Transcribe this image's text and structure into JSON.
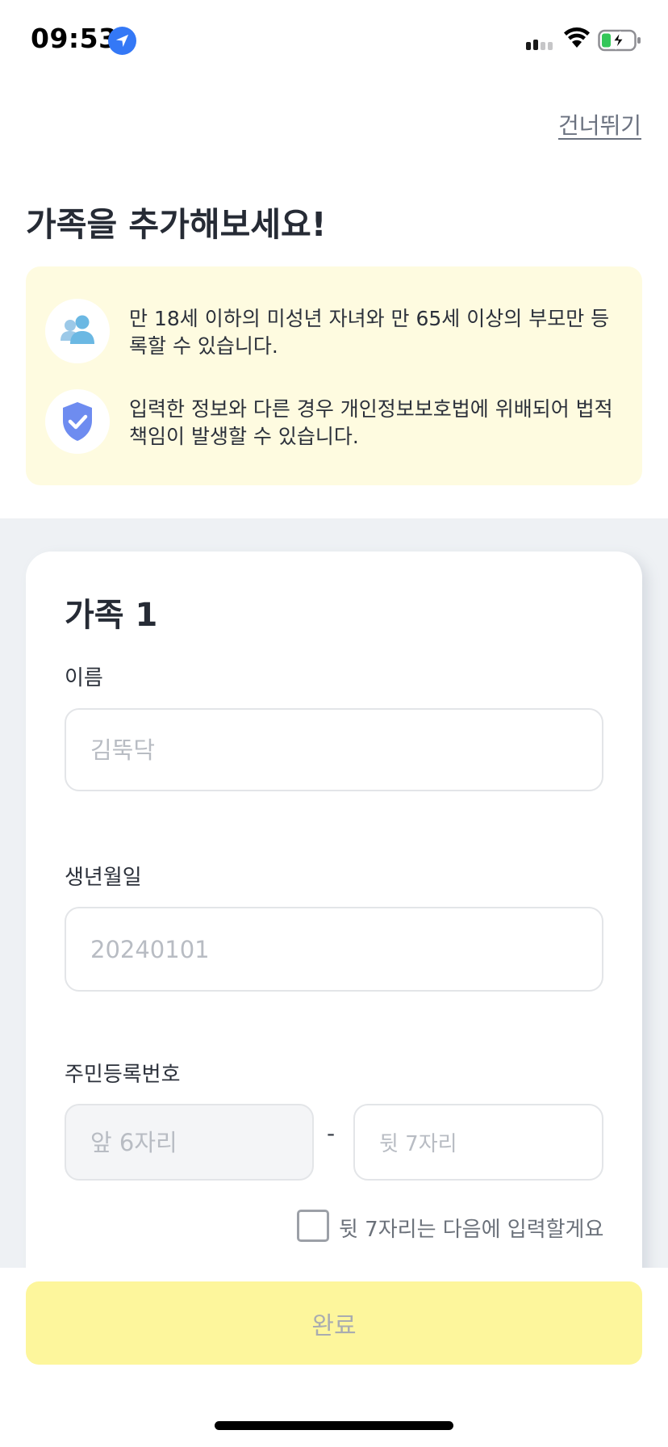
{
  "status_bar": {
    "time": "09:53",
    "icons": [
      "location-arrow-icon",
      "cellular-signal-icon",
      "wifi-icon",
      "battery-charging-icon"
    ],
    "accent_color": "#3478f6",
    "battery_color": "#34c759"
  },
  "header": {
    "skip_label": "건너뛰기",
    "title": "가족을 추가해보세요!"
  },
  "notice": {
    "background": "#fefbe0",
    "items": [
      {
        "icon": "family-icon",
        "text": "만 18세 이하의 미성년 자녀와 만 65세 이상의 부모만 등록할 수 있습니다."
      },
      {
        "icon": "shield-check-icon",
        "text": "입력한 정보와 다른 경우 개인정보보호법에 위배되어 법적 책임이 발생할 수 있습니다."
      }
    ]
  },
  "form": {
    "card_title": "가족 1",
    "name": {
      "label": "이름",
      "value": "",
      "placeholder": "김뚝닥"
    },
    "birthdate": {
      "label": "생년월일",
      "value": "",
      "placeholder": "20240101"
    },
    "rrn": {
      "label": "주민등록번호",
      "front": {
        "value": "",
        "placeholder": "앞 6자리"
      },
      "separator": "-",
      "back": {
        "value": "",
        "placeholder": "뒷 7자리"
      }
    },
    "later_checkbox": {
      "label": "뒷 7자리는 다음에 입력할게요",
      "checked": false
    }
  },
  "footer": {
    "complete_label": "완료",
    "button_color": "#fdf69c"
  }
}
